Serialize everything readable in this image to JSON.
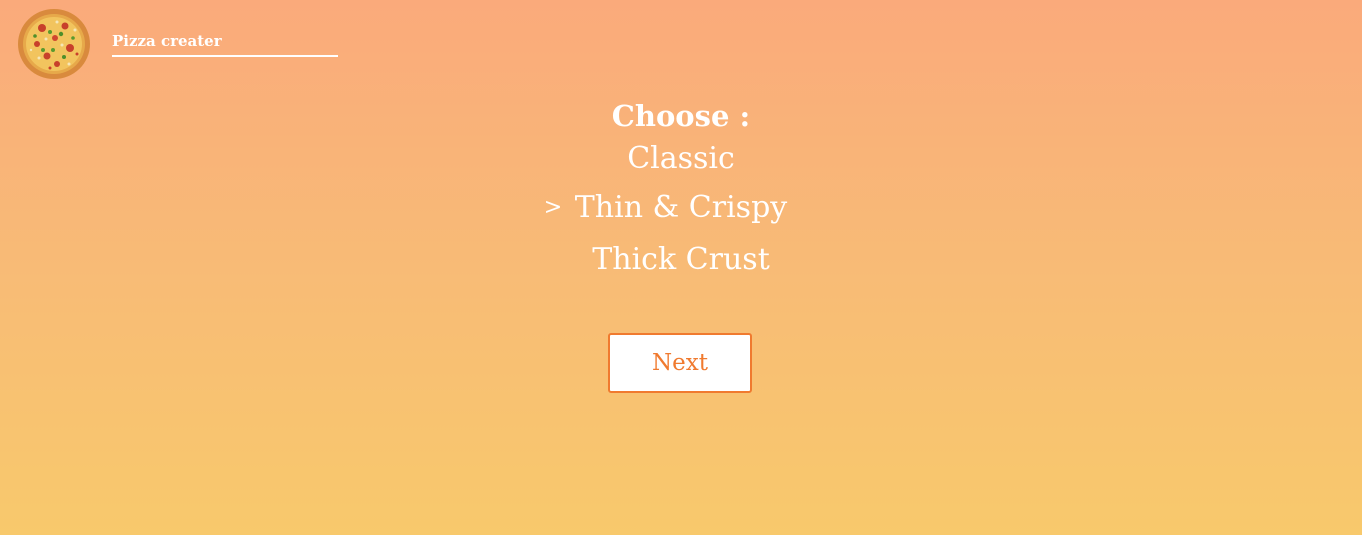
{
  "header": {
    "brand_title": "Pizza creater",
    "logo_icon": "pizza-icon"
  },
  "chooser": {
    "heading": "Choose :",
    "selected_marker": ">",
    "selected_index": 1,
    "options": [
      {
        "label": "Classic",
        "selected": false
      },
      {
        "label": "Thin & Crispy",
        "selected": true
      },
      {
        "label": "Thick Crust",
        "selected": false
      }
    ]
  },
  "actions": {
    "next_label": "Next"
  },
  "colors": {
    "background_top": "#faaa7b",
    "background_bottom": "#f8c96c",
    "accent": "#f07a2f",
    "text": "#ffffff"
  }
}
